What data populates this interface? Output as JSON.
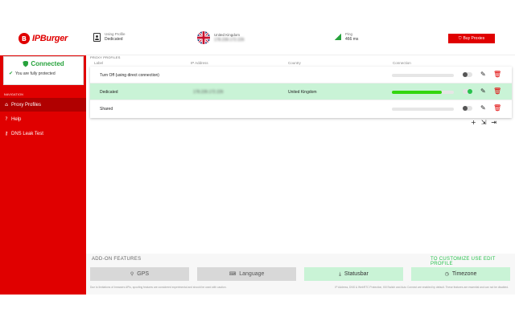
{
  "brand": {
    "logo_text": "IPBurger",
    "logo_mark": "B"
  },
  "status": {
    "title": "Connected",
    "subtitle": "You are fully protected"
  },
  "navigation": {
    "heading": "NAVIGATION",
    "items": [
      {
        "label": "Proxy Profiles",
        "icon": "home-icon",
        "active": true
      },
      {
        "label": "Help",
        "icon": "question-icon",
        "active": false
      },
      {
        "label": "DNS Leak Test",
        "icon": "key-icon",
        "active": false
      }
    ]
  },
  "header": {
    "using_profile_label": "Using Profile",
    "using_profile_value": "Dedicated",
    "country_label": "United Kingdom",
    "ip_value": "178.239.172.226",
    "ping_label": "Ping",
    "ping_value": "466 ms",
    "buy_label": "Buy Proxies"
  },
  "proxy_profiles": {
    "section_label": "PROXY PROFILES",
    "columns": [
      "Label",
      "IP Address",
      "Country",
      "Connection"
    ],
    "rows": [
      {
        "label": "Turn Off (using direct connection)",
        "ip": "",
        "country": "",
        "connection": 0,
        "active": false
      },
      {
        "label": "Dedicated",
        "ip": "178.239.172.226",
        "country": "United Kingdom",
        "connection": 0.8,
        "active": true
      },
      {
        "label": "Shared",
        "ip": "",
        "country": "",
        "connection": 0,
        "active": false
      }
    ]
  },
  "addons": {
    "title": "ADD-ON FEATURES",
    "customize": "TO CUSTOMIZE USE EDIT PROFILE",
    "buttons": [
      {
        "label": "GPS",
        "icon": "location-pin-icon",
        "enabled": false
      },
      {
        "label": "Language",
        "icon": "keyboard-icon",
        "enabled": false
      },
      {
        "label": "Statusbar",
        "icon": "download-icon",
        "enabled": true
      },
      {
        "label": "Timezone",
        "icon": "clock-icon",
        "enabled": true
      }
    ],
    "footnote_left": "Due to limitations of browsers APIs, spoofing features are considered experimental and should be used with caution.",
    "footnote_right": "IP Address, DNS & WebRTC Protection, Kill Switch and Auto Connect are enabled by default. These features are essential and can not be disabled."
  },
  "colors": {
    "brand_red": "#e00000",
    "active_green": "#27c24c",
    "active_row": "#c9f3d6"
  }
}
